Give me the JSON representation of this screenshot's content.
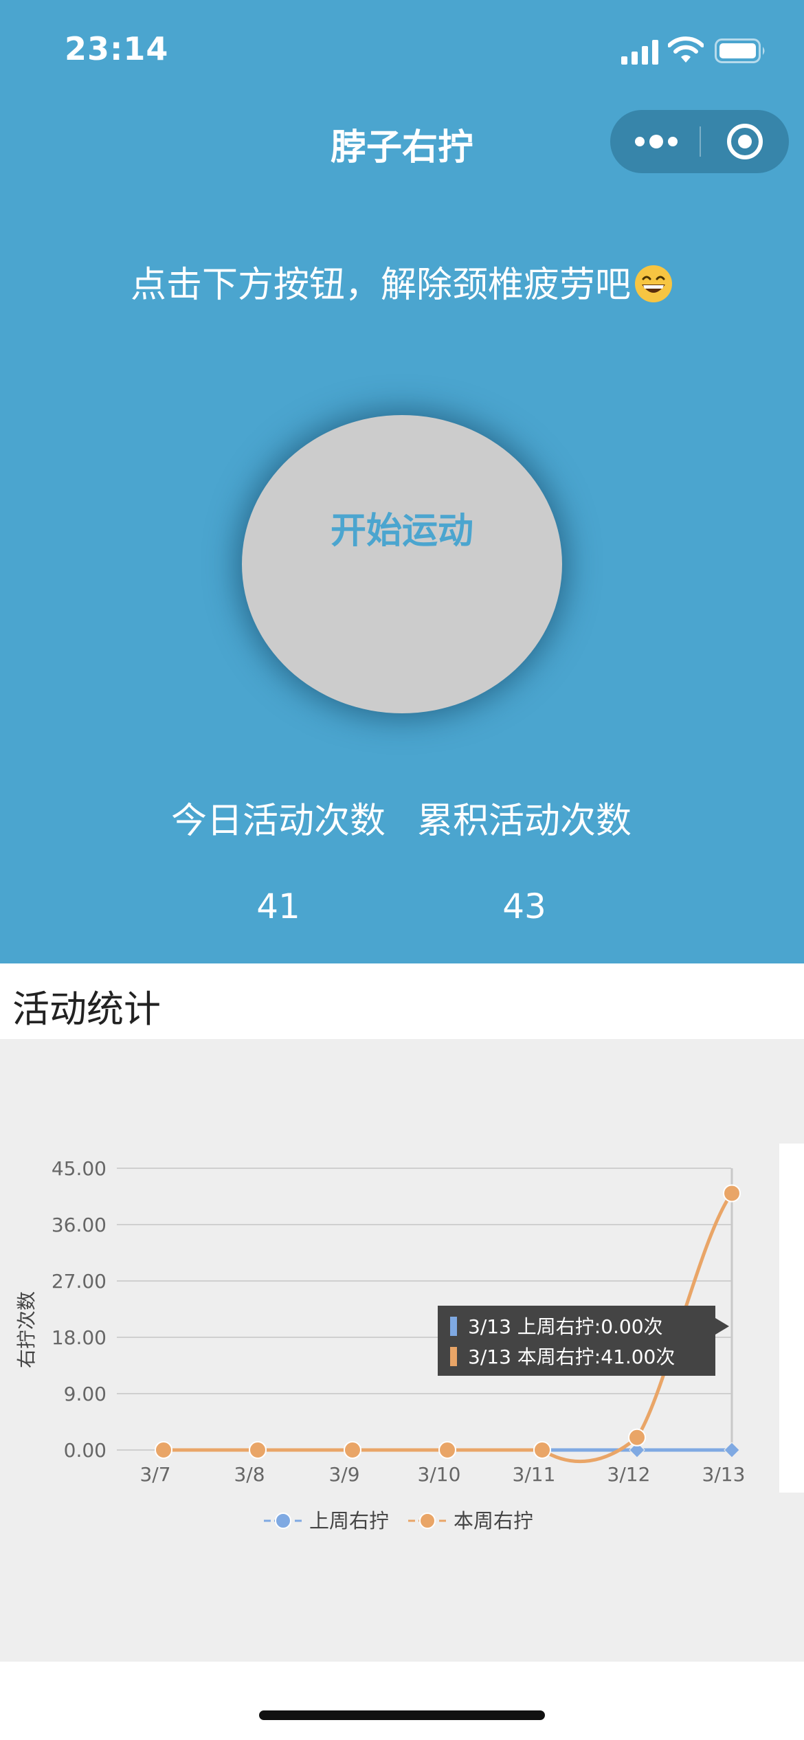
{
  "status_bar": {
    "time": "23:14"
  },
  "nav": {
    "title": "脖子右拧"
  },
  "hint": "点击下方按钮，解除颈椎疲劳吧",
  "start_button": {
    "label": "开始运动"
  },
  "stats": {
    "today_label": "今日活动次数",
    "total_label": "累积活动次数",
    "today_value": "41",
    "total_value": "43"
  },
  "section": {
    "title": "活动统计"
  },
  "colors": {
    "primary": "#4ba5cf",
    "last_week_series": "#7fa9e2",
    "this_week_series": "#e9a567",
    "panel_bg": "#eeeeee"
  },
  "chart_data": {
    "type": "line",
    "ylabel": "右拧次数",
    "xlabel": "",
    "categories": [
      "3/7",
      "3/8",
      "3/9",
      "3/10",
      "3/11",
      "3/12",
      "3/13"
    ],
    "ylim": [
      0,
      45
    ],
    "yticks": [
      "0.00",
      "9.00",
      "18.00",
      "27.00",
      "36.00",
      "45.00"
    ],
    "grid": true,
    "legend": "bottom",
    "series": [
      {
        "name": "上周右拧",
        "values": [
          0,
          0,
          0,
          0,
          0,
          0,
          0
        ],
        "marker": "diamond"
      },
      {
        "name": "本周右拧",
        "values": [
          0,
          0,
          0,
          0,
          0,
          2,
          41
        ],
        "marker": "circle"
      }
    ],
    "tooltip": {
      "category": "3/13",
      "lines": [
        "3/13 上周右拧:0.00次",
        "3/13 本周右拧:41.00次"
      ]
    }
  }
}
